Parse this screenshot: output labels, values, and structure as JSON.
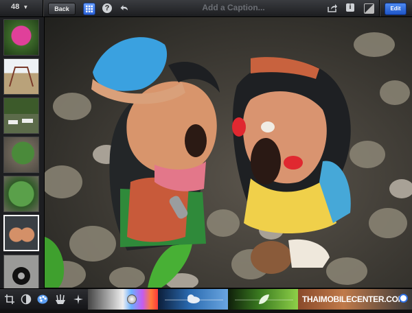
{
  "toolbar": {
    "photo_count": "48",
    "back_label": "Back",
    "help_label": "?",
    "caption_placeholder": "Add a Caption...",
    "info_label": "i",
    "edit_label": "Edit"
  },
  "sidebar": {
    "thumbnails": [
      "pink-flower",
      "playground-swing",
      "garden-benches",
      "green-plant",
      "palm-plant",
      "doll-figurines",
      "wheel-sculpture"
    ],
    "selected_index": 5
  },
  "photo": {
    "subject": "clay-doll-figurines"
  },
  "bottom_tools": [
    "crop-icon",
    "exposure-icon",
    "color-icon",
    "brushes-icon",
    "effects-icon"
  ],
  "watermark": {
    "text": "THAIMOBILECENTER.COM"
  },
  "colors": {
    "accent": "#2f6fe0",
    "toolbar": "#2a2b2f"
  }
}
